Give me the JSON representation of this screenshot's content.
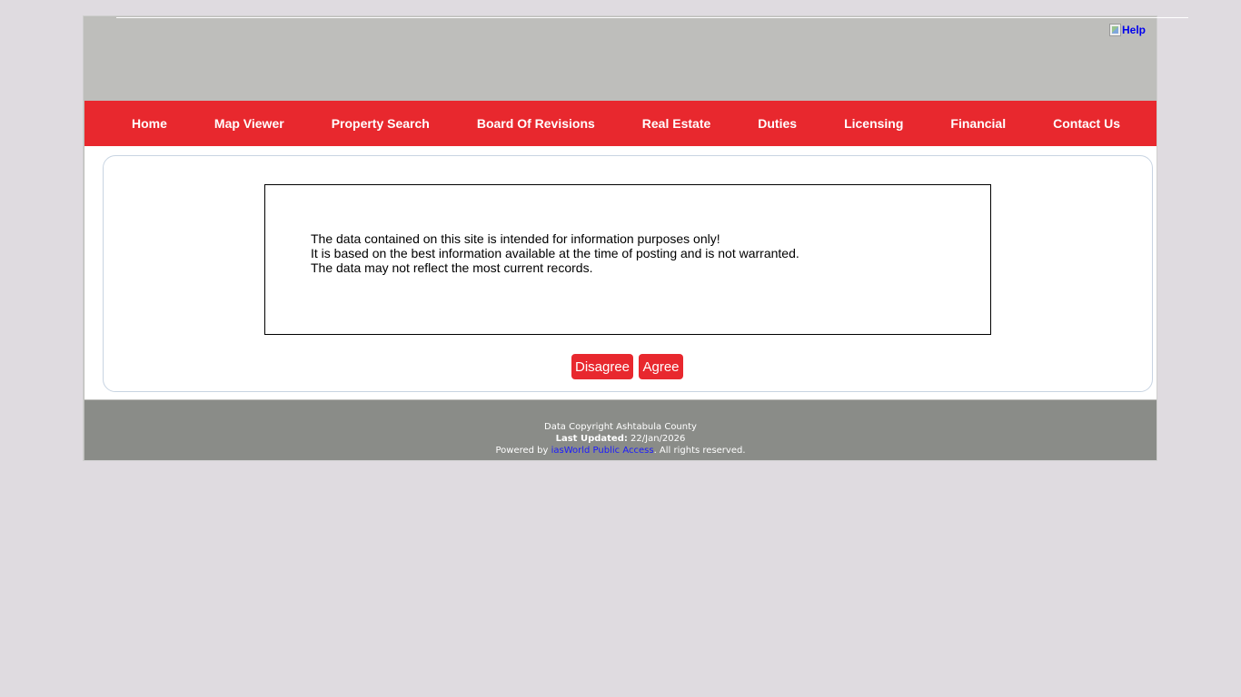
{
  "header": {
    "help_label": "Help"
  },
  "nav": {
    "items": [
      {
        "label": "Home"
      },
      {
        "label": "Map Viewer"
      },
      {
        "label": "Property Search"
      },
      {
        "label": "Board Of Revisions"
      },
      {
        "label": "Real Estate"
      },
      {
        "label": "Duties"
      },
      {
        "label": "Licensing"
      },
      {
        "label": "Financial"
      },
      {
        "label": "Contact Us"
      }
    ]
  },
  "disclaimer": {
    "line1": "The data contained on this site is intended for information purposes only!",
    "line2": "It is based on the best information available at the time of posting and is not warranted.",
    "line3": "The data may not reflect the most current records."
  },
  "buttons": {
    "disagree": "Disagree",
    "agree": "Agree"
  },
  "footer": {
    "copyright": "Data Copyright Ashtabula County",
    "last_updated_label": "Last Updated:",
    "last_updated_value": " 22/Jan/2026",
    "powered_prefix": "Powered by ",
    "powered_link": "iasWorld Public Access",
    "powered_suffix": ". All rights reserved."
  },
  "colors": {
    "brand_red": "#e8282e",
    "header_gray": "#bebebb",
    "footer_gray": "#8a8c88",
    "page_bg": "#dfdbe0"
  },
  "icons": {
    "help": "broken-image-icon"
  }
}
